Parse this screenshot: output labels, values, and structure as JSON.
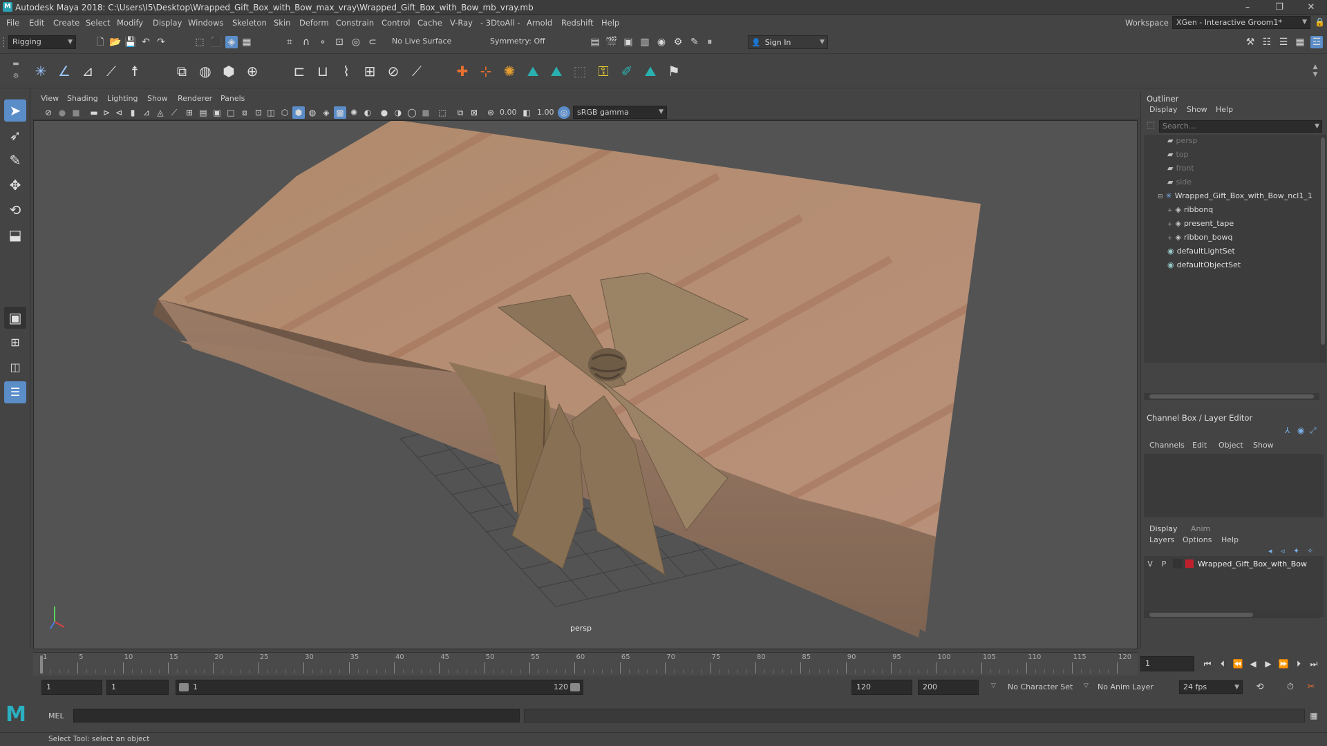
{
  "window": {
    "title": "Autodesk Maya 2018: C:\\Users\\I5\\Desktop\\Wrapped_Gift_Box_with_Bow_max_vray\\Wrapped_Gift_Box_with_Bow_mb_vray.mb",
    "minimize": "–",
    "restore": "❐",
    "close": "✕"
  },
  "menu": [
    "File",
    "Edit",
    "Create",
    "Select",
    "Modify",
    "Display",
    "Windows",
    "Skeleton",
    "Skin",
    "Deform",
    "Constrain",
    "Control",
    "Cache",
    "V-Ray",
    "- 3DtoAll -",
    "Arnold",
    "Redshift",
    "Help"
  ],
  "workspace": {
    "label": "Workspace :",
    "value": "XGen - Interactive Groom1*"
  },
  "statusline": {
    "mode": "Rigging",
    "live_surface": "No Live Surface",
    "symmetry": "Symmetry: Off",
    "sign_in": "Sign In"
  },
  "viewport_menu": [
    "View",
    "Shading",
    "Lighting",
    "Show",
    "Renderer",
    "Panels"
  ],
  "viewport_bar": {
    "exposure": "0.00",
    "gamma": "1.00",
    "color_space": "sRGB gamma"
  },
  "viewport": {
    "camera_label": "persp"
  },
  "outliner": {
    "title": "Outliner",
    "menu": [
      "Display",
      "Show",
      "Help"
    ],
    "search_placeholder": "Search...",
    "items": [
      {
        "label": "persp",
        "dim": true
      },
      {
        "label": "top",
        "dim": true
      },
      {
        "label": "front",
        "dim": true
      },
      {
        "label": "side",
        "dim": true
      },
      {
        "label": "Wrapped_Gift_Box_with_Bow_ncl1_1",
        "dim": false
      },
      {
        "label": "ribbonq",
        "dim": false
      },
      {
        "label": "present_tape",
        "dim": false
      },
      {
        "label": "ribbon_bowq",
        "dim": false
      },
      {
        "label": "defaultLightSet",
        "dim": false
      },
      {
        "label": "defaultObjectSet",
        "dim": false
      }
    ]
  },
  "channelbox": {
    "title": "Channel Box / Layer Editor",
    "menu": [
      "Channels",
      "Edit",
      "Object",
      "Show"
    ]
  },
  "layer_editor": {
    "tabs": [
      "Display",
      "Anim"
    ],
    "menu": [
      "Layers",
      "Options",
      "Help"
    ],
    "layer": {
      "v": "V",
      "p": "P",
      "name": "Wrapped_Gift_Box_with_Bow",
      "color": "#c0202c"
    }
  },
  "timeline": {
    "ticks": [
      "1",
      "5",
      "10",
      "15",
      "20",
      "25",
      "30",
      "35",
      "40",
      "45",
      "50",
      "55",
      "60",
      "65",
      "70",
      "75",
      "80",
      "85",
      "90",
      "95",
      "100",
      "105",
      "110",
      "115",
      "120"
    ],
    "current_frame": "1"
  },
  "range": {
    "start": "1",
    "inner_start": "1",
    "slider_start": "1",
    "slider_end": "120",
    "end": "120",
    "anim_end": "200",
    "character_set": "No Character Set",
    "anim_layer": "No Anim Layer",
    "fps": "24 fps"
  },
  "cmdline": {
    "label": "MEL"
  },
  "helpline": {
    "text": "Select Tool: select an object"
  },
  "colors": {
    "accent": "#5b8dc9",
    "viewport_bg": "#535353"
  }
}
